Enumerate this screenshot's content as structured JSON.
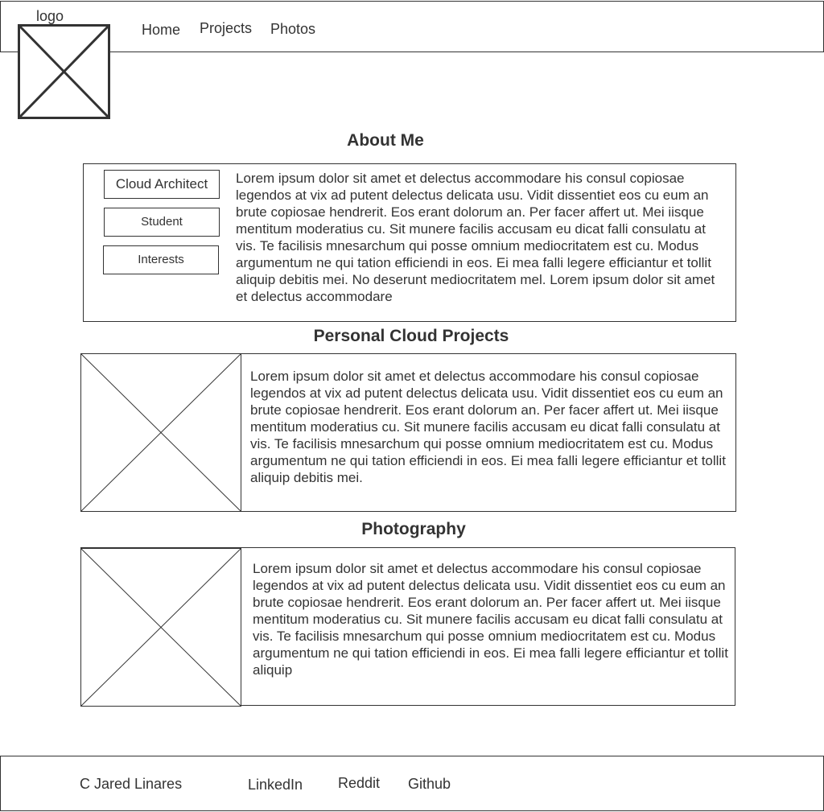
{
  "header": {
    "logo_label": "logo",
    "nav": [
      "Home",
      "Projects",
      "Photos"
    ]
  },
  "about": {
    "title": "About Me",
    "tags": [
      "Cloud Architect",
      "Student",
      "Interests"
    ],
    "text": "Lorem ipsum dolor sit amet et delectus accommodare his consul copiosae legendos at vix ad putent delectus delicata usu. Vidit dissentiet eos cu eum an brute copiosae hendrerit. Eos erant dolorum an. Per facer affert ut. Mei iisque mentitum moderatius cu. Sit munere facilis accusam eu dicat falli consulatu at vis. Te facilisis mnesarchum qui posse omnium mediocritatem est cu. Modus argumentum ne qui tation efficiendi in eos. Ei mea falli legere efficiantur et tollit aliquip debitis mei. No deserunt mediocritatem mel. Lorem ipsum dolor sit amet et delectus accommodare"
  },
  "projects": {
    "title": "Personal Cloud Projects",
    "text": "Lorem ipsum dolor sit amet et delectus accommodare his consul copiosae legendos at vix ad putent delectus delicata usu. Vidit dissentiet eos cu eum an brute copiosae hendrerit. Eos erant dolorum an. Per facer affert ut. Mei iisque mentitum moderatius cu. Sit munere facilis accusam eu dicat falli consulatu at vis. Te facilisis mnesarchum qui posse omnium mediocritatem est cu. Modus argumentum ne qui tation efficiendi in eos. Ei mea falli legere efficiantur et tollit aliquip debitis mei."
  },
  "photography": {
    "title": "Photography",
    "text": "Lorem ipsum dolor sit amet et delectus accommodare his consul copiosae legendos at vix ad putent delectus delicata usu. Vidit dissentiet eos cu eum an brute copiosae hendrerit. Eos erant dolorum an. Per facer affert ut. Mei iisque mentitum moderatius cu. Sit munere facilis accusam eu dicat falli consulatu at vis. Te facilisis mnesarchum qui posse omnium mediocritatem est cu. Modus argumentum ne qui tation efficiendi in eos. Ei mea falli legere efficiantur et tollit aliquip"
  },
  "footer": {
    "name": "C Jared Linares",
    "links": [
      "LinkedIn",
      "Reddit",
      "Github"
    ]
  },
  "colors": {
    "stroke": "#333333",
    "background": "#ffffff"
  }
}
